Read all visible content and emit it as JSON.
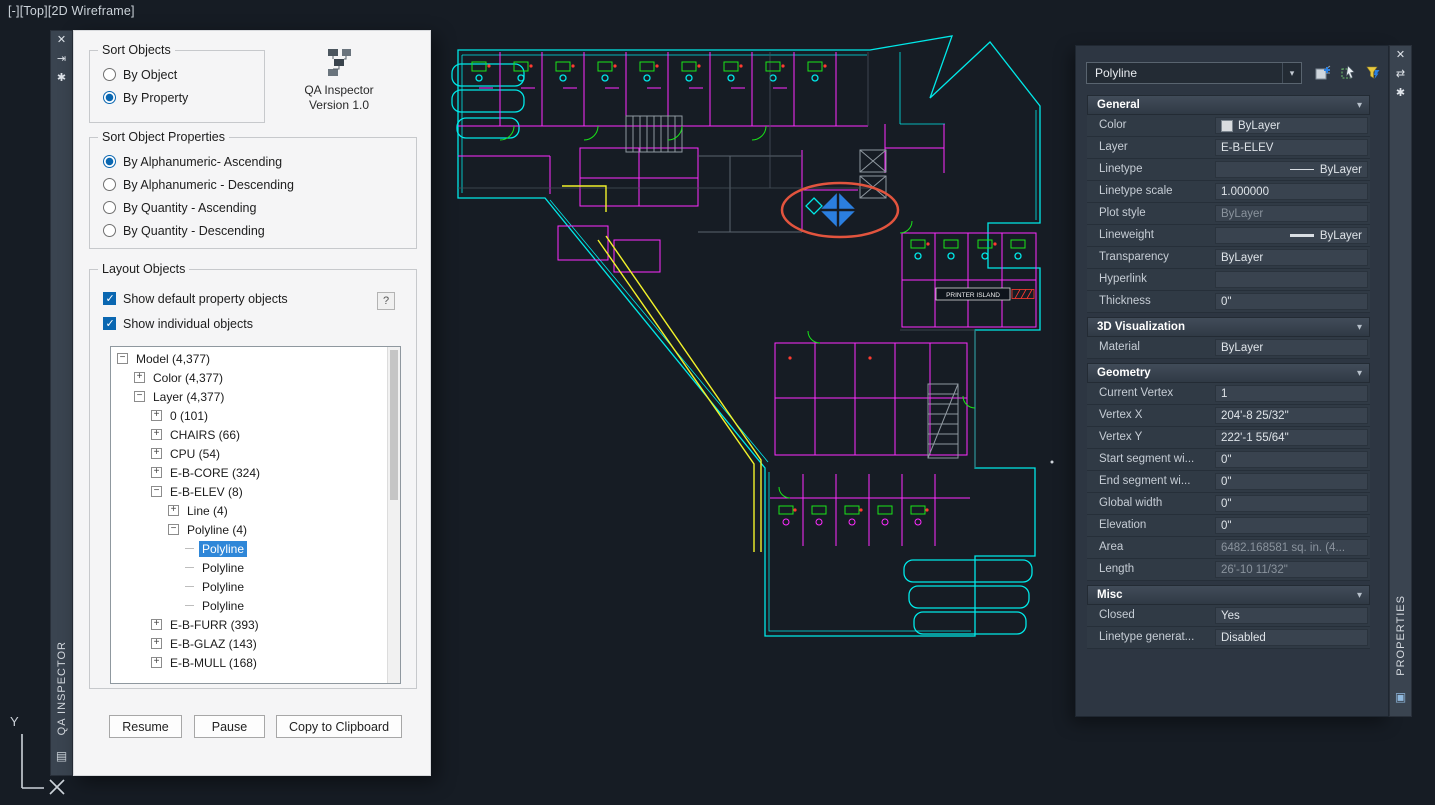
{
  "viewport": {
    "controls": [
      "[-]",
      "[Top]",
      "[2D Wireframe]"
    ]
  },
  "icons": {
    "close": "✕",
    "auto_hide": "⇥",
    "settings": "✱",
    "swap": "⇄",
    "doc": "▤",
    "monitor": "▣",
    "chevron_down": "▾",
    "expand": "+",
    "collapse": "−"
  },
  "qa_inspector": {
    "strip_title": "QA INSPECTOR",
    "sort_objects": {
      "title": "Sort Objects",
      "options": [
        {
          "label": "By Object",
          "selected": false
        },
        {
          "label": "By Property",
          "selected": true
        }
      ]
    },
    "branding": {
      "line1": "QA Inspector",
      "line2": "Version 1.0"
    },
    "sort_object_properties": {
      "title": "Sort Object Properties",
      "options": [
        {
          "label": "By Alphanumeric- Ascending",
          "selected": true
        },
        {
          "label": "By Alphanumeric - Descending",
          "selected": false
        },
        {
          "label": "By Quantity - Ascending",
          "selected": false
        },
        {
          "label": "By Quantity - Descending",
          "selected": false
        }
      ]
    },
    "layout_objects": {
      "title": "Layout Objects",
      "help_label": "?",
      "checkboxes": [
        {
          "label": "Show default property objects",
          "checked": true
        },
        {
          "label": "Show individual objects",
          "checked": true
        }
      ],
      "tree": [
        {
          "label": "Model (4,377)",
          "level": 0,
          "expander": "minus"
        },
        {
          "label": "Color (4,377)",
          "level": 1,
          "expander": "plus"
        },
        {
          "label": "Layer (4,377)",
          "level": 1,
          "expander": "minus"
        },
        {
          "label": "0 (101)",
          "level": 2,
          "expander": "plus"
        },
        {
          "label": "CHAIRS (66)",
          "level": 2,
          "expander": "plus"
        },
        {
          "label": "CPU (54)",
          "level": 2,
          "expander": "plus"
        },
        {
          "label": "E-B-CORE (324)",
          "level": 2,
          "expander": "plus"
        },
        {
          "label": "E-B-ELEV (8)",
          "level": 2,
          "expander": "minus"
        },
        {
          "label": "Line (4)",
          "level": 3,
          "expander": "plus"
        },
        {
          "label": "Polyline (4)",
          "level": 3,
          "expander": "minus"
        },
        {
          "label": "Polyline",
          "level": 4,
          "expander": "none",
          "selected": true
        },
        {
          "label": "Polyline",
          "level": 4,
          "expander": "none"
        },
        {
          "label": "Polyline",
          "level": 4,
          "expander": "none"
        },
        {
          "label": "Polyline",
          "level": 4,
          "expander": "none"
        },
        {
          "label": "E-B-FURR (393)",
          "level": 2,
          "expander": "plus"
        },
        {
          "label": "E-B-GLAZ (143)",
          "level": 2,
          "expander": "plus"
        },
        {
          "label": "E-B-MULL (168)",
          "level": 2,
          "expander": "plus"
        }
      ]
    },
    "buttons": [
      "Resume",
      "Pause",
      "Copy to Clipboard"
    ]
  },
  "properties_panel": {
    "strip_title": "PROPERTIES",
    "selector": {
      "value": "Polyline"
    },
    "sections": [
      {
        "title": "General",
        "rows": [
          {
            "label": "Color",
            "value": "ByLayer",
            "swatch": true
          },
          {
            "label": "Layer",
            "value": "E-B-ELEV"
          },
          {
            "label": "Linetype",
            "value": "ByLayer",
            "line_preview": true
          },
          {
            "label": "Linetype scale",
            "value": "1.000000"
          },
          {
            "label": "Plot style",
            "value": "ByLayer",
            "disabled": true
          },
          {
            "label": "Lineweight",
            "value": "ByLayer",
            "line_preview": true,
            "thick": true
          },
          {
            "label": "Transparency",
            "value": "ByLayer"
          },
          {
            "label": "Hyperlink",
            "value": ""
          },
          {
            "label": "Thickness",
            "value": "0\""
          }
        ]
      },
      {
        "title": "3D Visualization",
        "rows": [
          {
            "label": "Material",
            "value": "ByLayer"
          }
        ]
      },
      {
        "title": "Geometry",
        "rows": [
          {
            "label": "Current Vertex",
            "value": "1"
          },
          {
            "label": "Vertex X",
            "value": "204'-8 25/32\""
          },
          {
            "label": "Vertex Y",
            "value": "222'-1 55/64\""
          },
          {
            "label": "Start segment wi...",
            "value": "0\""
          },
          {
            "label": "End segment wi...",
            "value": "0\""
          },
          {
            "label": "Global width",
            "value": "0\""
          },
          {
            "label": "Elevation",
            "value": "0\""
          },
          {
            "label": "Area",
            "value": "6482.168581 sq. in. (4...",
            "disabled": true
          },
          {
            "label": "Length",
            "value": "26'-10 11/32\"",
            "disabled": true
          }
        ]
      },
      {
        "title": "Misc",
        "rows": [
          {
            "label": "Closed",
            "value": "Yes"
          },
          {
            "label": "Linetype generat...",
            "value": "Disabled"
          }
        ]
      }
    ]
  },
  "drawing": {
    "printer_island_label": "PRINTER ISLAND"
  },
  "colors": {
    "accent_blue": "#0a67b1",
    "tree_selection_blue": "#2f87d8",
    "highlight_red": "#e2543e",
    "selected_grip_blue": "#2b7fe0",
    "cad_cyan": "#00e8e8",
    "cad_magenta": "#ff2bff",
    "cad_yellow": "#f2f22a",
    "cad_green": "#19e619"
  }
}
